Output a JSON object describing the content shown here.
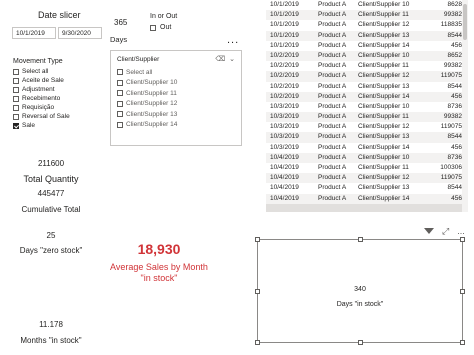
{
  "date_slicer": {
    "title": "Date slicer",
    "start": "10/1/2019",
    "end": "9/30/2020"
  },
  "days": {
    "value": "365",
    "label": "Days"
  },
  "in_or_out": {
    "title": "In or Out",
    "options": [
      {
        "label": "Out",
        "checked": false
      }
    ]
  },
  "movement_type": {
    "title": "Movement Type",
    "items": [
      {
        "label": "Select all",
        "checked": false
      },
      {
        "label": "Aceite de Sale",
        "checked": false
      },
      {
        "label": "Adjustment",
        "checked": false
      },
      {
        "label": "Recebimento",
        "checked": false
      },
      {
        "label": "Requisição",
        "checked": false
      },
      {
        "label": "Reversal of Sale",
        "checked": false
      },
      {
        "label": "Sale",
        "checked": true
      }
    ]
  },
  "client_slicer": {
    "title": "Client/Supplier",
    "items": [
      {
        "label": "Select all",
        "checked": false
      },
      {
        "label": "Client/Supplier 10",
        "checked": false
      },
      {
        "label": "Client/Supplier 11",
        "checked": false
      },
      {
        "label": "Client/Supplier 12",
        "checked": false
      },
      {
        "label": "Client/Supplier 13",
        "checked": false
      },
      {
        "label": "Client/Supplier 14",
        "checked": false
      }
    ]
  },
  "more_options": "...",
  "cards": {
    "total_quantity": {
      "value": "211600",
      "label": "Total Quantity"
    },
    "cumulative_total": {
      "value": "445477",
      "label": "Cumulative Total"
    },
    "days_zero_stock": {
      "value": "25",
      "label": "Days \"zero stock\""
    },
    "months_in_stock": {
      "value": "11.178",
      "label": "Months \"in stock\""
    },
    "days_in_stock": {
      "value": "340",
      "label": "Days \"in stock\""
    }
  },
  "average_sales": {
    "value": "18,930",
    "label": "Average Sales by Month \"in stock\""
  },
  "table": {
    "rows": [
      [
        "10/1/2019",
        "Product A",
        "Client/Supplier 10",
        "8628"
      ],
      [
        "10/1/2019",
        "Product A",
        "Client/Supplier 11",
        "99382"
      ],
      [
        "10/1/2019",
        "Product A",
        "Client/Supplier 12",
        "118835"
      ],
      [
        "10/1/2019",
        "Product A",
        "Client/Supplier 13",
        "8544"
      ],
      [
        "10/1/2019",
        "Product A",
        "Client/Supplier 14",
        "456"
      ],
      [
        "10/2/2019",
        "Product A",
        "Client/Supplier 10",
        "8652"
      ],
      [
        "10/2/2019",
        "Product A",
        "Client/Supplier 11",
        "99382"
      ],
      [
        "10/2/2019",
        "Product A",
        "Client/Supplier 12",
        "119075"
      ],
      [
        "10/2/2019",
        "Product A",
        "Client/Supplier 13",
        "8544"
      ],
      [
        "10/2/2019",
        "Product A",
        "Client/Supplier 14",
        "456"
      ],
      [
        "10/3/2019",
        "Product A",
        "Client/Supplier 10",
        "8736"
      ],
      [
        "10/3/2019",
        "Product A",
        "Client/Supplier 11",
        "99382"
      ],
      [
        "10/3/2019",
        "Product A",
        "Client/Supplier 12",
        "119075"
      ],
      [
        "10/3/2019",
        "Product A",
        "Client/Supplier 13",
        "8544"
      ],
      [
        "10/3/2019",
        "Product A",
        "Client/Supplier 14",
        "456"
      ],
      [
        "10/4/2019",
        "Product A",
        "Client/Supplier 10",
        "8736"
      ],
      [
        "10/4/2019",
        "Product A",
        "Client/Supplier 11",
        "100306"
      ],
      [
        "10/4/2019",
        "Product A",
        "Client/Supplier 12",
        "119075"
      ],
      [
        "10/4/2019",
        "Product A",
        "Client/Supplier 13",
        "8544"
      ],
      [
        "10/4/2019",
        "Product A",
        "Client/Supplier 14",
        "456"
      ]
    ]
  },
  "colors": {
    "accent_red": "#d13438",
    "text": "#252423",
    "border": "#c8c6c4"
  },
  "icons": [
    "eraser-icon",
    "chevron-down-icon",
    "filter-icon",
    "focus-mode-icon",
    "more-options-icon"
  ]
}
